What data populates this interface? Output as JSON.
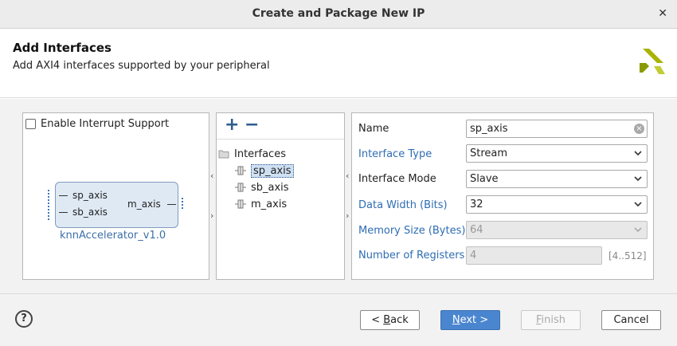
{
  "window": {
    "title": "Create and Package New IP",
    "close_glyph": "✕"
  },
  "header": {
    "title": "Add Interfaces",
    "subtitle": "Add AXI4 interfaces supported by your peripheral",
    "logo_icon": "xilinx-logo"
  },
  "symbol_panel": {
    "interrupt_label": "Enable Interrupt Support",
    "interrupt_checked": false,
    "block": {
      "left_ports": [
        "sp_axis",
        "sb_axis"
      ],
      "right_ports": [
        "m_axis"
      ],
      "name": "knnAccelerator_v1.0"
    }
  },
  "tree_panel": {
    "add_glyph": "+",
    "remove_glyph": "−",
    "root_label": "Interfaces",
    "items": [
      "sp_axis",
      "sb_axis",
      "m_axis"
    ],
    "selected_index": 0
  },
  "properties": {
    "name": {
      "label": "Name",
      "value": "sp_axis"
    },
    "interface_type": {
      "label": "Interface Type",
      "value": "Stream"
    },
    "interface_mode": {
      "label": "Interface Mode",
      "value": "Slave"
    },
    "data_width": {
      "label": "Data Width (Bits)",
      "value": "32"
    },
    "memory_size": {
      "label": "Memory Size (Bytes)",
      "value": "64"
    },
    "num_registers": {
      "label": "Number of Registers",
      "value": "4",
      "range": "[4..512]"
    }
  },
  "footer": {
    "help_glyph": "?",
    "back_underlined": "B",
    "back_rest": "ack",
    "back_prefix": "< ",
    "next_underlined": "N",
    "next_rest": "ext >",
    "finish_underlined": "F",
    "finish_rest": "inish",
    "cancel_label": "Cancel"
  },
  "colors": {
    "accent": "#4a86d0",
    "link_label": "#2f6db3",
    "logo": "#a8b400"
  }
}
